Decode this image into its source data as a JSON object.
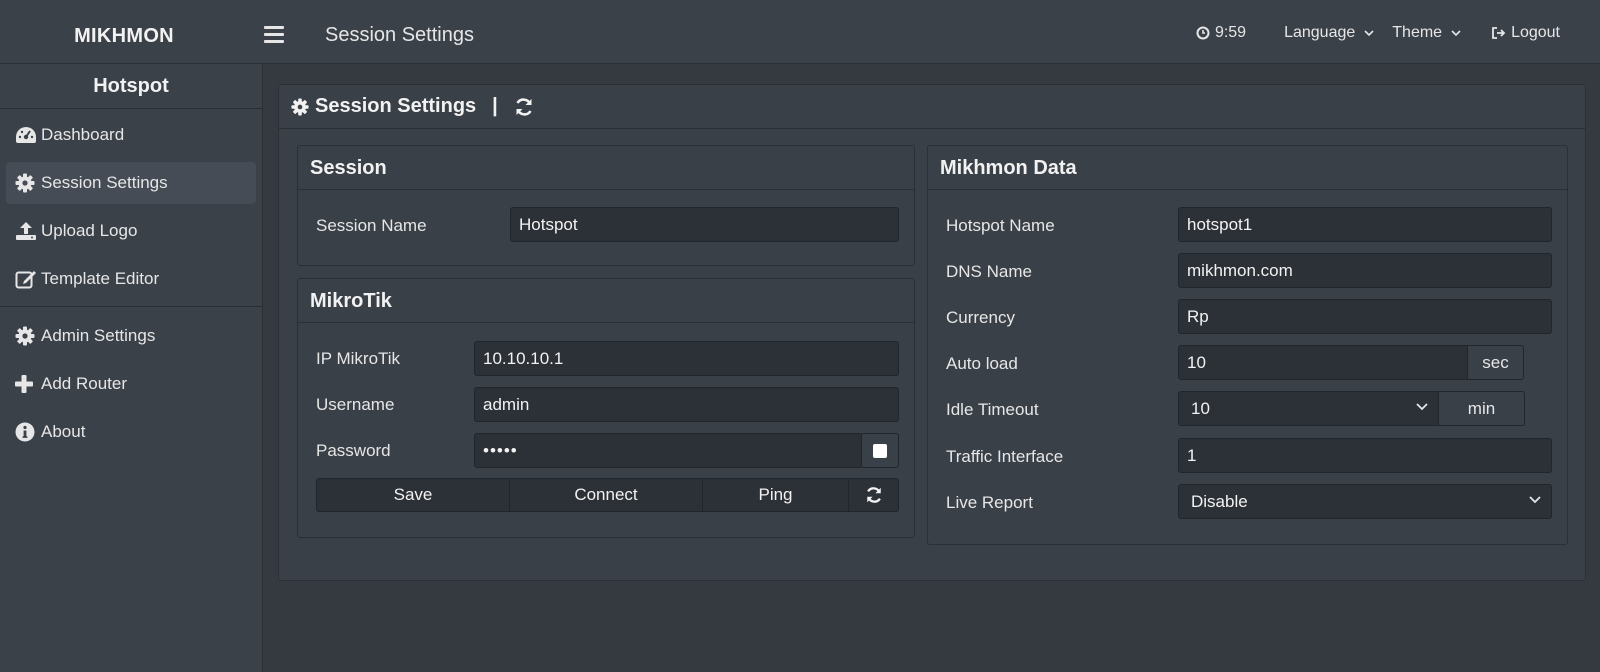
{
  "brand": "MIKHMON",
  "header": {
    "title": "Session Settings",
    "time": "9:59",
    "language_label": "Language",
    "theme_label": "Theme",
    "logout_label": "Logout"
  },
  "sidebar": {
    "title": "Hotspot",
    "items": [
      {
        "label": "Dashboard",
        "icon": "dashboard-icon"
      },
      {
        "label": "Session Settings",
        "icon": "gear-icon",
        "active": true
      },
      {
        "label": "Upload Logo",
        "icon": "upload-icon"
      },
      {
        "label": "Template Editor",
        "icon": "edit-icon"
      },
      {
        "label": "Admin Settings",
        "icon": "gear-icon"
      },
      {
        "label": "Add Router",
        "icon": "plus-icon"
      },
      {
        "label": "About",
        "icon": "info-icon"
      }
    ]
  },
  "main": {
    "title": "Session Settings",
    "separator": "|"
  },
  "session": {
    "title": "Session",
    "name_label": "Session Name",
    "name_value": "Hotspot"
  },
  "mikrotik": {
    "title": "MikroTik",
    "ip_label": "IP MikroTik",
    "ip_value": "10.10.10.1",
    "username_label": "Username",
    "username_value": "admin",
    "password_label": "Password",
    "password_value": "•••••",
    "save_label": "Save",
    "connect_label": "Connect",
    "ping_label": "Ping"
  },
  "mikhmon_data": {
    "title": "Mikhmon Data",
    "hotspot_name_label": "Hotspot Name",
    "hotspot_name_value": "hotspot1",
    "dns_label": "DNS Name",
    "dns_value": "mikhmon.com",
    "currency_label": "Currency",
    "currency_value": "Rp",
    "auto_load_label": "Auto load",
    "auto_load_value": "10",
    "auto_load_unit": "sec",
    "idle_timeout_label": "Idle Timeout",
    "idle_timeout_value": "10",
    "idle_timeout_unit": "min",
    "traffic_label": "Traffic Interface",
    "traffic_value": "1",
    "live_report_label": "Live Report",
    "live_report_value": "Disable"
  },
  "colors": {
    "background": "#343a40",
    "panel": "#3a4048",
    "input": "#2c3037",
    "text": "#e6e6e6"
  }
}
